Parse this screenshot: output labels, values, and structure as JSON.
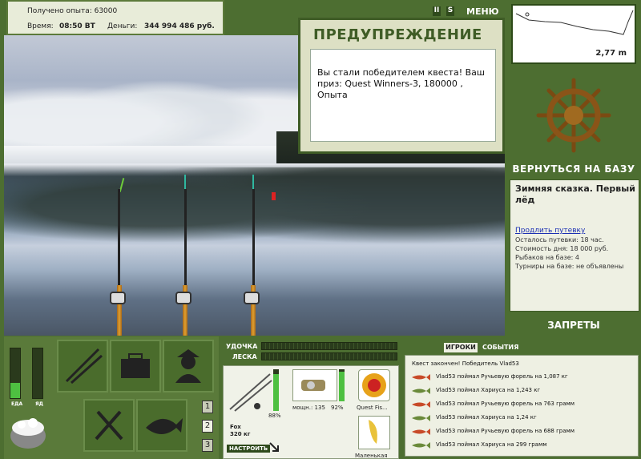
{
  "hud": {
    "exp_label": "Получено опыта: 63000",
    "time_label": "Время:",
    "time_value": "08:50 ВТ",
    "money_label": "Деньги:",
    "money_value": "344 994 486 руб."
  },
  "topbar": {
    "pause": "II",
    "sound": "S",
    "menu": "МЕНЮ"
  },
  "depth": {
    "value": "2,77 m"
  },
  "warning": {
    "title": "ПРЕДУПРЕЖДЕНИЕ",
    "message": "Вы стали победителем квеста! Ваш приз: Quest Winners-3, 180000 , Опыта"
  },
  "base": {
    "return_label": "ВЕРНУТЬСЯ НА БАЗУ"
  },
  "location": {
    "name": "Зимняя сказка. Первый лёд",
    "extend_link": "Продлить путевку",
    "rows": [
      "Осталось путевки: 18 час.",
      "Стоимость дня: 18 000 руб.",
      "Рыбаков на базе: 4",
      "Турниры на базе: не объявлены"
    ]
  },
  "bans_label": "ЗАПРЕТЫ",
  "status": {
    "food_label": "ЕДА",
    "poison_label": "ЯД",
    "food_level": 0.3,
    "poison_level": 0
  },
  "pages": [
    "1",
    "2",
    "3"
  ],
  "tackle": {
    "rod_label": "УДОЧКА",
    "line_label": "ЛЕСКА",
    "rod_name": "Fox",
    "rod_weight": "320 кг",
    "rod_percent": "88%",
    "setup_button": "НАСТРОИТЬ",
    "reel_power": "мощн.: 135",
    "reel_percent": "92%",
    "line_name": "Quest Fis...",
    "bait_name": "Маленькая"
  },
  "chat": {
    "tab_players": "ИГРОКИ",
    "tab_events": "СОБЫТИЯ",
    "lines": [
      "Квест закончен! Победитель Vlad53",
      "Vlad53 поймал Ручьевую форель на 1,087 кг",
      "Vlad53 поймал Хариуса на 1,243 кг",
      "Vlad53 поймал Ручьевую форель на 763 грамм",
      "Vlad53 поймал Хариуса на 1,24 кг",
      "Vlad53 поймал Ручьевую форель на 688 грамм",
      "Vlad53 поймал Хариуса на 299 грамм"
    ]
  },
  "colors": {
    "panel": "#4d6e31",
    "accent": "#3f5c26",
    "gauge_fill": "#4ec041"
  }
}
